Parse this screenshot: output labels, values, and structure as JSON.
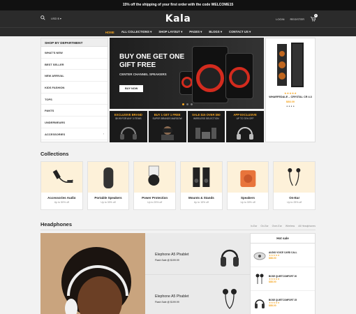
{
  "topbar": {
    "text": "15% off the shipping of your first order with the code WELCOME15"
  },
  "header": {
    "logo": "Kala",
    "currency": "USD $ ▾",
    "login": "LOGIN",
    "register": "REGISTER",
    "cart_count": "0"
  },
  "nav": {
    "items": [
      "HOME",
      "ALL COLLECTIONS ▾",
      "SHOP LAYOUT ▾",
      "PAGES ▾",
      "BLOGS ▾",
      "CONTACT US ▾"
    ]
  },
  "dept": {
    "title": "SHOP BY DEPARTMENT",
    "items": [
      "WHAT'S NEW",
      "BEST SELLER",
      "NEW ARRIVAL",
      "KIDS FASHION",
      "TOPS",
      "PANTS",
      "UNDERWEARS",
      "ACCESSORIES"
    ]
  },
  "slide": {
    "title": "BUY ONE GET ONE GIFT FREE",
    "subtitle": "CENTER CHANNEL SPEAKERS",
    "button": "BUY NOW"
  },
  "side_product": {
    "stars": "★★★★★",
    "name": "WHARFEDALE – CRYSTAL CR 4.3",
    "price": "$88.00"
  },
  "banners": [
    {
      "title": "EXCLUSIVE BRAND",
      "sub": "$9.99 FOR ANY 3 ITEMS"
    },
    {
      "title": "BUY 1 GET 1 FREE",
      "sub": "SUPER BRANDS MARDOW"
    },
    {
      "title": "SALE $15 OVER $50",
      "sub": "WIRELESS SELECTION"
    },
    {
      "title": "APP EXCLUSIVE",
      "sub": "UP TO 70% OFF"
    }
  ],
  "collections": {
    "title": "Collections",
    "items": [
      {
        "name": "Accessories Audio",
        "up": "Up to 50% off"
      },
      {
        "name": "Portable Speakers",
        "up": "Up to 30% off"
      },
      {
        "name": "Power Protection",
        "up": "Up to 25% off"
      },
      {
        "name": "Mounts & Stands",
        "up": "Up to 15% off"
      },
      {
        "name": "Speakers",
        "up": "Up to 30% off"
      },
      {
        "name": "On-Ear",
        "up": "Up to 25% off"
      }
    ]
  },
  "headphones": {
    "title": "Headphones",
    "links": [
      "In-Ear",
      "On-Ear",
      "Over-Ear",
      "Wireless",
      "All Headphones"
    ],
    "cards": [
      {
        "name": "Elephone A5 Phablet",
        "flash": "Flash Sale @ $199.99"
      },
      {
        "name": "Elephone A5 Phablet",
        "flash": "Flash Sale @ $199.99"
      }
    ],
    "hot": {
      "title": "Hot sale",
      "items": [
        {
          "name": "AUDIO VOICE CARD CALL",
          "stars": "★★★★★",
          "price": "$88.00"
        },
        {
          "name": "BOSE QUIETCOMFORT 20",
          "stars": "★★★★★",
          "price": "$88.00"
        },
        {
          "name": "BOSE QUIETCOMFORT 25",
          "stars": "★★★★★",
          "price": "$88.00"
        }
      ]
    }
  },
  "colors": {
    "accent": "#f5a623",
    "dark": "#2b2b2b",
    "promo_bg": "#fdf1d9"
  }
}
